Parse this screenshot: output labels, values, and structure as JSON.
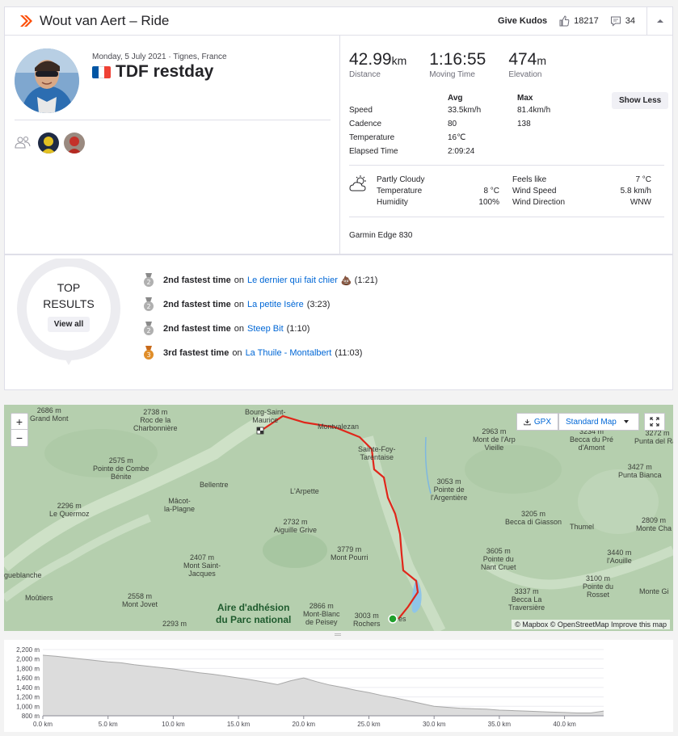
{
  "header": {
    "athlete": "Wout van Aert",
    "separator": "–",
    "activity_type": "Ride",
    "give_kudos": "Give Kudos",
    "kudos_count": "18217",
    "comment_count": "34"
  },
  "activity": {
    "date_location": "Monday, 5 July 2021 · Tignes, France",
    "title": "TDF restday",
    "flag_colors": [
      "#0055a4",
      "#ffffff",
      "#ef4135"
    ]
  },
  "stats": {
    "distance": {
      "value": "42.99",
      "unit": "km",
      "label": "Distance"
    },
    "moving_time": {
      "value": "1:16:55",
      "label": "Moving Time"
    },
    "elevation": {
      "value": "474",
      "unit": "m",
      "label": "Elevation"
    }
  },
  "more_stats": {
    "headers": [
      "",
      "Avg",
      "Max"
    ],
    "rows": [
      [
        "Speed",
        "33.5km/h",
        "81.4km/h"
      ],
      [
        "Cadence",
        "80",
        "138"
      ],
      [
        "Temperature",
        "16℃",
        ""
      ],
      [
        "Elapsed Time",
        "2:09:24",
        ""
      ]
    ],
    "show_less": "Show Less"
  },
  "weather": {
    "icon": "partly-cloudy-icon",
    "left": [
      {
        "label": "Partly Cloudy",
        "value": ""
      },
      {
        "label": "Temperature",
        "value": "8 °C"
      },
      {
        "label": "Humidity",
        "value": "100%"
      }
    ],
    "right": [
      {
        "label": "Feels like",
        "value": "7 °C"
      },
      {
        "label": "Wind Speed",
        "value": "5.8 km/h"
      },
      {
        "label": "Wind Direction",
        "value": "WNW"
      }
    ]
  },
  "device": "Garmin Edge 830",
  "top_results": {
    "line1": "TOP",
    "line2": "RESULTS",
    "view_all": "View all",
    "achievements": [
      {
        "rank_label": "2nd fastest time",
        "on": "on",
        "segment": "Le dernier qui fait chier",
        "emoji": "💩",
        "time": "(1:21)",
        "medal": "silver",
        "medal_num": "2"
      },
      {
        "rank_label": "2nd fastest time",
        "on": "on",
        "segment": "La petite Isère",
        "emoji": "",
        "time": "(3:23)",
        "medal": "silver",
        "medal_num": "2"
      },
      {
        "rank_label": "2nd fastest time",
        "on": "on",
        "segment": "Steep Bit",
        "emoji": "",
        "time": "(1:10)",
        "medal": "silver",
        "medal_num": "2"
      },
      {
        "rank_label": "3rd fastest time",
        "on": "on",
        "segment": "La Thuile - Montalbert",
        "emoji": "",
        "time": "(11:03)",
        "medal": "bronze",
        "medal_num": "3"
      }
    ]
  },
  "map": {
    "zoom_in": "+",
    "zoom_out": "−",
    "gpx": "GPX",
    "map_style": "Standard Map",
    "attribution": "© Mapbox © OpenStreetMap Improve this map",
    "route_color": "#e0261a",
    "labels": [
      "2686 m|Grand Mont",
      "2738 m|Roc de la|Charbonnière",
      "Bourg-Saint-|Maurice",
      "Montvalezan",
      "2963 m|Mont de l'Arp|Vieille",
      "3234 m|Becca du Pré|d'Amont",
      "3272 m|Punta del Ran",
      "Sainte-Foy-|Tarentaise",
      "2575 m|Pointe de Combe|Bénite",
      "3427 m|Punta Bianca",
      "Bellentre",
      "L'Arpette",
      "3053 m|Pointe de|l'Argentière",
      "2296 m|Le Quermoz",
      "Mâcot-|la-Plagne",
      "2732 m|Aiguille Grive",
      "3205 m|Becca di Giasson",
      "Thumel",
      "2809 m|Monte Cha",
      "3779 m|Mont Pourri",
      "3605 m|Pointe du|Nant Cruet",
      "3440 m|l'Aouille",
      "2407 m|Mont Saint-|Jacques",
      "3100 m|Pointe du|Rosset",
      "gueblanche",
      "2558 m|Mont Jovet",
      "Moûtiers",
      "Aire d'adhésion|du Parc national",
      "2866 m|Mont-Blanc|de Peisey",
      "3337 m|Becca La|Traversière",
      "Monte Gi",
      "2293 m",
      "3003 m|Rochers",
      "es"
    ]
  },
  "elevation_chart": {
    "type": "area",
    "x_unit": "km",
    "y_unit": "m",
    "x": [
      0,
      1,
      2,
      3,
      4,
      5,
      6,
      7,
      8,
      9,
      10,
      11,
      12,
      13,
      14,
      15,
      16,
      17,
      18,
      19,
      20,
      21,
      22,
      23,
      24,
      25,
      26,
      27,
      28,
      29,
      30,
      31,
      32,
      33,
      34,
      35,
      36,
      37,
      38,
      39,
      40,
      41,
      42,
      43
    ],
    "y": [
      2080,
      2060,
      2030,
      2000,
      1970,
      1940,
      1920,
      1880,
      1850,
      1820,
      1790,
      1750,
      1710,
      1680,
      1640,
      1600,
      1560,
      1510,
      1460,
      1540,
      1600,
      1520,
      1450,
      1400,
      1340,
      1290,
      1230,
      1180,
      1120,
      1060,
      1000,
      980,
      960,
      950,
      940,
      920,
      910,
      900,
      890,
      880,
      870,
      860,
      860,
      900
    ],
    "xlim": [
      0,
      43
    ],
    "ylim": [
      800,
      2200
    ],
    "xticks": [
      "0.0 km",
      "5.0 km",
      "10.0 km",
      "15.0 km",
      "20.0 km",
      "25.0 km",
      "30.0 km",
      "35.0 km",
      "40.0 km"
    ],
    "yticks": [
      "800 m",
      "1,000 m",
      "1,200 m",
      "1,400 m",
      "1,600 m",
      "1,800 m",
      "2,000 m",
      "2,200 m"
    ],
    "fill_color": "#dcdcdc",
    "line_color": "#a8a8a8"
  }
}
